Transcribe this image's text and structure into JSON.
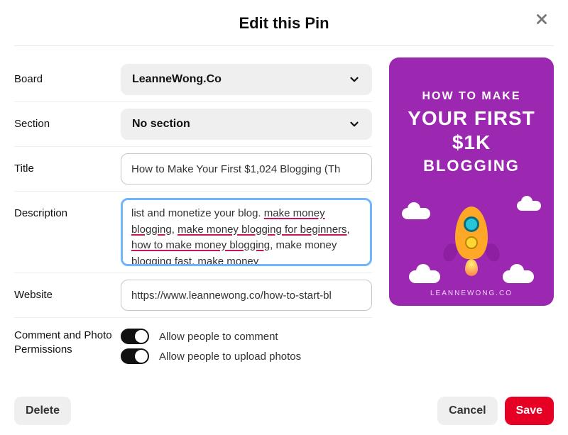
{
  "header": {
    "title": "Edit this Pin"
  },
  "form": {
    "board": {
      "label": "Board",
      "value": "LeanneWong.Co"
    },
    "section": {
      "label": "Section",
      "value": "No section"
    },
    "title": {
      "label": "Title",
      "value": "How to Make Your First $1,024 Blogging (Th"
    },
    "description": {
      "label": "Description",
      "text_prefix": "list and monetize your blog. ",
      "kw1": "make money blogging",
      "sep1": ", ",
      "kw2": "make money blogging for beginners",
      "sep2": ", ",
      "kw3": "how to make money blogging",
      "suffix": ", make money blogging fast, make money"
    },
    "website": {
      "label": "Website",
      "value": "https://www.leannewong.co/how-to-start-bl"
    },
    "permissions": {
      "label": "Comment and Photo Permissions",
      "allow_comment": "Allow people to comment",
      "allow_upload": "Allow people to upload photos"
    }
  },
  "preview": {
    "line1": "HOW TO MAKE",
    "line2": "YOUR FIRST",
    "line3": "$1K",
    "line4": "BLOGGING",
    "footer": "LEANNEWONG.CO"
  },
  "buttons": {
    "delete": "Delete",
    "cancel": "Cancel",
    "save": "Save"
  }
}
